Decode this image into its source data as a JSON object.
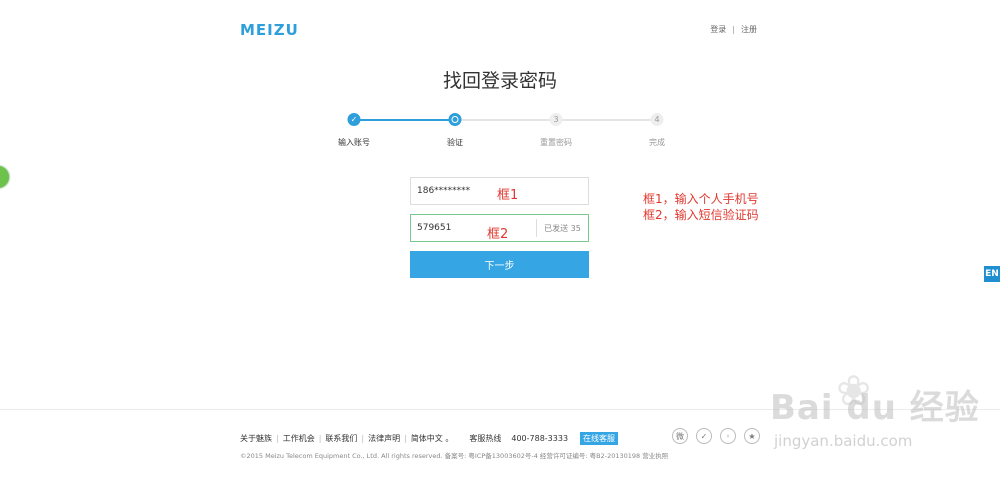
{
  "header": {
    "logo": "MEIZU",
    "login": "登录",
    "separator": "|",
    "register": "注册"
  },
  "title": "找回登录密码",
  "steps": [
    {
      "num": "✓",
      "label": "输入账号",
      "state": "done"
    },
    {
      "num": "",
      "label": "验证",
      "state": "current"
    },
    {
      "num": "3",
      "label": "重置密码",
      "state": "todo"
    },
    {
      "num": "4",
      "label": "完成",
      "state": "todo"
    }
  ],
  "form": {
    "phone_value": "186********",
    "code_value": "579651",
    "resend_label": "已发送 35",
    "next_label": "下一步",
    "box1_annotation": "框1",
    "box2_annotation": "框2"
  },
  "annotations": {
    "line1": "框1，输入个人手机号",
    "line2": "框2，输入短信验证码"
  },
  "side": {
    "en_label": "EN"
  },
  "footer": {
    "links": [
      "关于魅族",
      "工作机会",
      "联系我们",
      "法律声明",
      "简体中文 。"
    ],
    "hotline_label": "客服热线",
    "hotline_number": "400-788-3333",
    "online_service": "在线客服",
    "copyright": "©2015 Meizu Telecom Equipment Co., Ltd. All rights reserved.   备案号: 粤ICP备13003602号-4   经营许可证编号: 粤B2-20130198   营业执照"
  },
  "watermark": {
    "text": "Bai du 经验",
    "url": "jingyan.baidu.com"
  },
  "colors": {
    "accent": "#2f9fdc",
    "button": "#36a5e4",
    "annotation": "#e0382f",
    "valid_border": "#7ac991"
  }
}
